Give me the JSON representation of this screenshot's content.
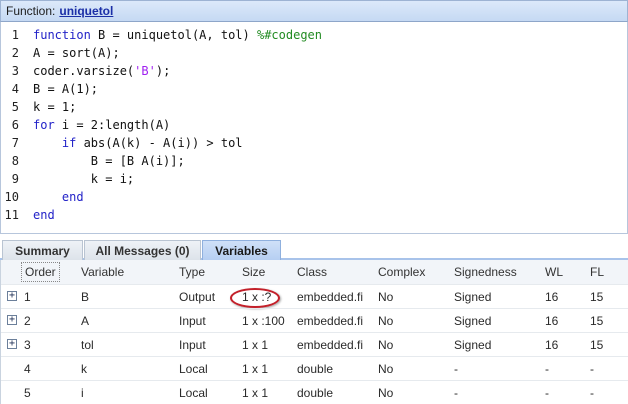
{
  "function_header": {
    "prefix": "Function:",
    "name": "uniquetol"
  },
  "code": {
    "lines": [
      {
        "num": "1",
        "parts": [
          {
            "t": "function",
            "c": "kw"
          },
          {
            "t": " B = uniquetol(A, tol) ",
            "c": ""
          },
          {
            "t": "%#codegen",
            "c": "cmt"
          }
        ]
      },
      {
        "num": "2",
        "parts": [
          {
            "t": "A = sort(A);",
            "c": ""
          }
        ]
      },
      {
        "num": "3",
        "parts": [
          {
            "t": "coder.varsize(",
            "c": ""
          },
          {
            "t": "'B'",
            "c": "str"
          },
          {
            "t": ");",
            "c": ""
          }
        ]
      },
      {
        "num": "4",
        "parts": [
          {
            "t": "B = A(1);",
            "c": ""
          }
        ]
      },
      {
        "num": "5",
        "parts": [
          {
            "t": "k = 1;",
            "c": ""
          }
        ]
      },
      {
        "num": "6",
        "parts": [
          {
            "t": "for",
            "c": "kw"
          },
          {
            "t": " i = 2:length(A)",
            "c": ""
          }
        ]
      },
      {
        "num": "7",
        "parts": [
          {
            "t": "    ",
            "c": ""
          },
          {
            "t": "if",
            "c": "kw"
          },
          {
            "t": " abs(A(k) - A(i)) > tol",
            "c": ""
          }
        ]
      },
      {
        "num": "8",
        "parts": [
          {
            "t": "        B = [B A(i)];",
            "c": ""
          }
        ]
      },
      {
        "num": "9",
        "parts": [
          {
            "t": "        k = i;",
            "c": ""
          }
        ]
      },
      {
        "num": "10",
        "parts": [
          {
            "t": "    ",
            "c": ""
          },
          {
            "t": "end",
            "c": "kw"
          }
        ]
      },
      {
        "num": "11",
        "parts": [
          {
            "t": "end",
            "c": "kw"
          }
        ]
      }
    ]
  },
  "tabs": [
    {
      "label": "Summary",
      "active": false
    },
    {
      "label": "All Messages (0)",
      "active": false
    },
    {
      "label": "Variables",
      "active": true
    }
  ],
  "table": {
    "columns": {
      "order": "Order",
      "variable": "Variable",
      "type": "Type",
      "size": "Size",
      "class": "Class",
      "complex": "Complex",
      "signedness": "Signedness",
      "wl": "WL",
      "fl": "FL"
    },
    "rows": [
      {
        "expandable": true,
        "order": "1",
        "variable": "B",
        "type": "Output",
        "size": "1 x :?",
        "class": "embedded.fi",
        "complex": "No",
        "signedness": "Signed",
        "wl": "16",
        "fl": "15",
        "highlight_size": true
      },
      {
        "expandable": true,
        "order": "2",
        "variable": "A",
        "type": "Input",
        "size": "1 x :100",
        "class": "embedded.fi",
        "complex": "No",
        "signedness": "Signed",
        "wl": "16",
        "fl": "15",
        "highlight_size": false
      },
      {
        "expandable": true,
        "order": "3",
        "variable": "tol",
        "type": "Input",
        "size": "1 x 1",
        "class": "embedded.fi",
        "complex": "No",
        "signedness": "Signed",
        "wl": "16",
        "fl": "15",
        "highlight_size": false
      },
      {
        "expandable": false,
        "order": "4",
        "variable": "k",
        "type": "Local",
        "size": "1 x 1",
        "class": "double",
        "complex": "No",
        "signedness": "-",
        "wl": "-",
        "fl": "-",
        "highlight_size": false
      },
      {
        "expandable": false,
        "order": "5",
        "variable": "i",
        "type": "Local",
        "size": "1 x 1",
        "class": "double",
        "complex": "No",
        "signedness": "-",
        "wl": "-",
        "fl": "-",
        "highlight_size": false
      }
    ],
    "expander_glyph": "+"
  },
  "colors": {
    "keyword": "#2222c8",
    "string": "#a020f0",
    "comment": "#228b22",
    "highlight_ellipse": "#c3202a",
    "active_tab": "#b6cff2"
  }
}
